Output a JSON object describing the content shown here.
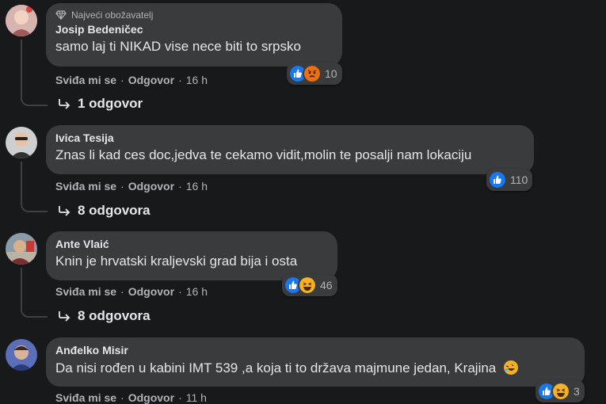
{
  "comments": [
    {
      "badge": "Najveći obožavatelj",
      "author": "Josip Bedeničec",
      "text": "samo laj ti NIKAD vise nece biti to srpsko",
      "reaction_count": "10",
      "reactions": [
        "like-icon",
        "angry-icon"
      ],
      "actions": {
        "like": "Sviđa mi se",
        "reply": "Odgovor",
        "time": "16 h"
      },
      "replies": "1 odgovor"
    },
    {
      "author": "Ivica Tesija",
      "text": "Znas li kad ces doc,jedva te cekamo vidit,molin te posalji nam lokaciju",
      "reaction_count": "110",
      "reactions": [
        "like-icon"
      ],
      "actions": {
        "like": "Sviđa mi se",
        "reply": "Odgovor",
        "time": "16 h"
      },
      "replies": "8 odgovora"
    },
    {
      "author": "Ante Vlaić",
      "text": "Knin je hrvatski kraljevski grad bija i osta",
      "reaction_count": "46",
      "reactions": [
        "like-icon",
        "haha-icon"
      ],
      "actions": {
        "like": "Sviđa mi se",
        "reply": "Odgovor",
        "time": "16 h"
      },
      "replies": "8 odgovora"
    },
    {
      "author": "Anđelko Misir",
      "text": "Da nisi rođen u kabini IMT 539 ,a koja ti to država majmune jedan, Krajina",
      "reaction_count": "3",
      "reactions": [
        "like-icon",
        "haha-icon"
      ],
      "actions": {
        "like": "Sviđa mi se",
        "reply": "Odgovor",
        "time": "11 h"
      }
    }
  ],
  "colors": {
    "background": "#18191a",
    "bubble": "#3a3b3c",
    "like": "#1877f2",
    "haha": "#f7b125",
    "angry": "#e9710f",
    "muted": "#b0b3b8"
  }
}
